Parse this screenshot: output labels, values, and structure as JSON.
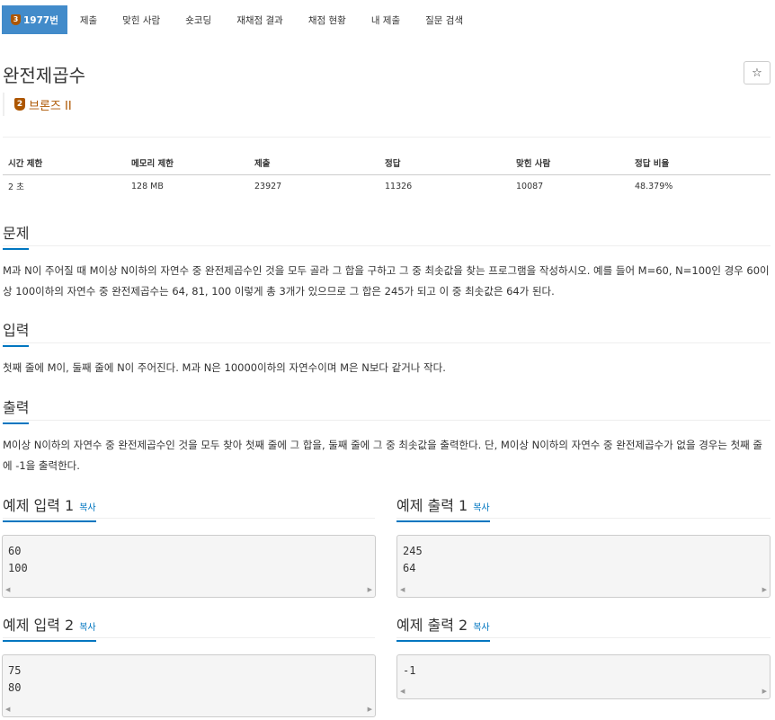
{
  "nav": {
    "tabs": [
      {
        "label": "1977번",
        "medal": "3"
      },
      {
        "label": "제출"
      },
      {
        "label": "맞힌 사람"
      },
      {
        "label": "숏코딩"
      },
      {
        "label": "재채점 결과"
      },
      {
        "label": "채점 현황"
      },
      {
        "label": "내 제출"
      },
      {
        "label": "질문 검색"
      }
    ]
  },
  "problem": {
    "title": "완전제곱수",
    "star": "☆",
    "tier_medal": "2",
    "tier_label": "브론즈 II"
  },
  "info": {
    "headers": [
      "시간 제한",
      "메모리 제한",
      "제출",
      "정답",
      "맞힌 사람",
      "정답 비율"
    ],
    "values": [
      "2 초",
      "128 MB",
      "23927",
      "11326",
      "10087",
      "48.379%"
    ]
  },
  "sections": {
    "problem_head": "문제",
    "problem_text": "M과 N이 주어질 때 M이상 N이하의 자연수 중 완전제곱수인 것을 모두 골라 그 합을 구하고 그 중 최솟값을 찾는 프로그램을 작성하시오. 예를 들어 M=60, N=100인 경우 60이상 100이하의 자연수 중 완전제곱수는 64, 81, 100 이렇게 총 3개가 있으므로 그 합은 245가 되고 이 중 최솟값은 64가 된다.",
    "input_head": "입력",
    "input_text": "첫째 줄에 M이, 둘째 줄에 N이 주어진다. M과 N은 10000이하의 자연수이며 M은 N보다 같거나 작다.",
    "output_head": "출력",
    "output_text": "M이상 N이하의 자연수 중 완전제곱수인 것을 모두 찾아 첫째 줄에 그 합을, 둘째 줄에 그 중 최솟값을 출력한다. 단, M이상 N이하의 자연수 중 완전제곱수가 없을 경우는 첫째 줄에 -1을 출력한다."
  },
  "samples": {
    "copy_label": "복사",
    "in1_head": "예제 입력 1",
    "in1_body": "60\n100",
    "out1_head": "예제 출력 1",
    "out1_body": "245\n64",
    "in2_head": "예제 입력 2",
    "in2_body": "75\n80",
    "out2_head": "예제 출력 2",
    "out2_body": "-1",
    "scroll_left": "◀",
    "scroll_right": "▶"
  },
  "colors": {
    "accent": "#428bca",
    "link": "#0076c0",
    "bronze": "#ad5600"
  }
}
